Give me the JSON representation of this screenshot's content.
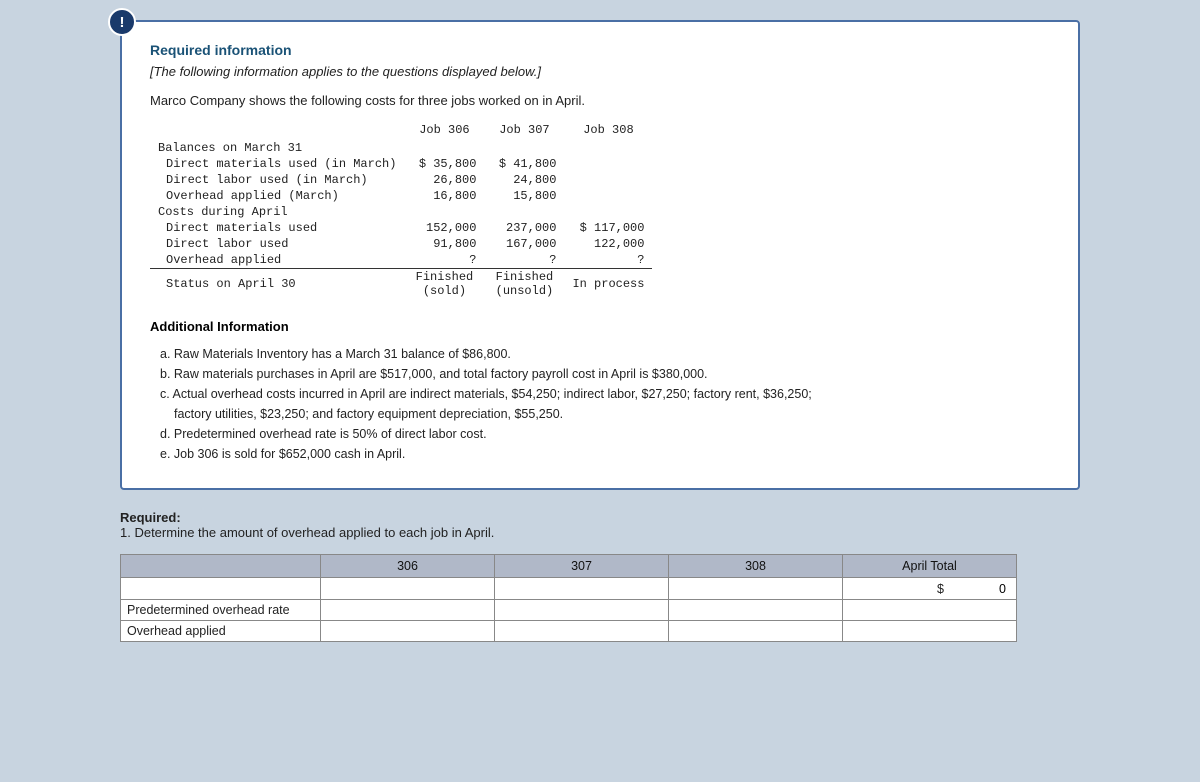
{
  "alert_icon": "!",
  "info_box": {
    "required_info_label": "Required information",
    "italic_subtitle": "[The following information applies to the questions displayed below.]",
    "intro": "Marco Company shows the following costs for three jobs worked on in April.",
    "table": {
      "columns": [
        "",
        "Job 306",
        "Job 307",
        "Job 308"
      ],
      "rows": [
        {
          "label": "Balances on March 31",
          "values": [
            "",
            "",
            ""
          ]
        },
        {
          "label": "  Direct materials used (in March)",
          "values": [
            "$ 35,800",
            "$ 41,800",
            ""
          ]
        },
        {
          "label": "  Direct labor used (in March)",
          "values": [
            "26,800",
            "24,800",
            ""
          ]
        },
        {
          "label": "  Overhead applied (March)",
          "values": [
            "16,800",
            "15,800",
            ""
          ]
        },
        {
          "label": "Costs during April",
          "values": [
            "",
            "",
            ""
          ]
        },
        {
          "label": "  Direct materials used",
          "values": [
            "152,000",
            "237,000",
            "$ 117,000"
          ]
        },
        {
          "label": "  Direct labor used",
          "values": [
            "91,800",
            "167,000",
            "122,000"
          ]
        },
        {
          "label": "  Overhead applied",
          "values": [
            "?",
            "?",
            "?"
          ]
        },
        {
          "label": "  Status on April 30",
          "values": [
            "Finished\n(sold)",
            "Finished\n(unsold)",
            "In process"
          ]
        }
      ]
    },
    "additional_info_title": "Additional Information",
    "additional_info_items": [
      "a. Raw Materials Inventory has a March 31 balance of $86,800.",
      "b. Raw materials purchases in April are $517,000, and total factory payroll cost in April is $380,000.",
      "c. Actual overhead costs incurred in April are indirect materials, $54,250; indirect labor, $27,250; factory rent, $36,250;",
      "   factory utilities, $23,250; and factory equipment depreciation, $55,250.",
      "d. Predetermined overhead rate is 50% of direct labor cost.",
      "e. Job 306 is sold for $652,000 cash in April."
    ]
  },
  "required_section": {
    "required_label": "Required:",
    "question_1": "1. Determine the amount of overhead applied to each job in April."
  },
  "input_table": {
    "headers": [
      "",
      "306",
      "307",
      "308",
      "April Total"
    ],
    "rows": [
      {
        "label": "",
        "values": [
          "",
          "",
          ""
        ],
        "april_total": "$  0",
        "is_first": true
      },
      {
        "label": "Predetermined overhead rate",
        "values": [
          "",
          "",
          ""
        ],
        "april_total": ""
      },
      {
        "label": "Overhead applied",
        "values": [
          "",
          "",
          ""
        ],
        "april_total": ""
      }
    ]
  }
}
